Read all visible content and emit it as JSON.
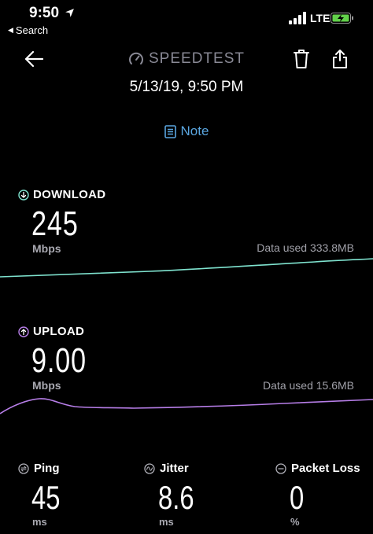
{
  "status_bar": {
    "time": "9:50",
    "back_label": "Search",
    "network": "LTE",
    "icons": [
      "location-arrow-icon",
      "signal-bars-icon",
      "battery-charging-icon"
    ]
  },
  "header": {
    "brand": "SPEEDTEST",
    "datetime": "5/13/19, 9:50 PM",
    "note_label": "Note",
    "icons": [
      "back-arrow-icon",
      "speedtest-gauge-icon",
      "trash-icon",
      "share-icon"
    ]
  },
  "download": {
    "label": "DOWNLOAD",
    "value": "245",
    "unit": "Mbps",
    "data_used": "Data used 333.8MB",
    "color": "#7fe3cf"
  },
  "upload": {
    "label": "UPLOAD",
    "value": "9.00",
    "unit": "Mbps",
    "data_used": "Data used 15.6MB",
    "color": "#b77ee8"
  },
  "stats": {
    "ping": {
      "label": "Ping",
      "value": "45",
      "unit": "ms"
    },
    "jitter": {
      "label": "Jitter",
      "value": "8.6",
      "unit": "ms"
    },
    "packet_loss": {
      "label": "Packet Loss",
      "value": "0",
      "unit": "%"
    }
  },
  "colors": {
    "background": "#000000",
    "brand_gray": "#8a8a96",
    "note_blue": "#5aa6e0",
    "battery_green": "#62d14a"
  }
}
